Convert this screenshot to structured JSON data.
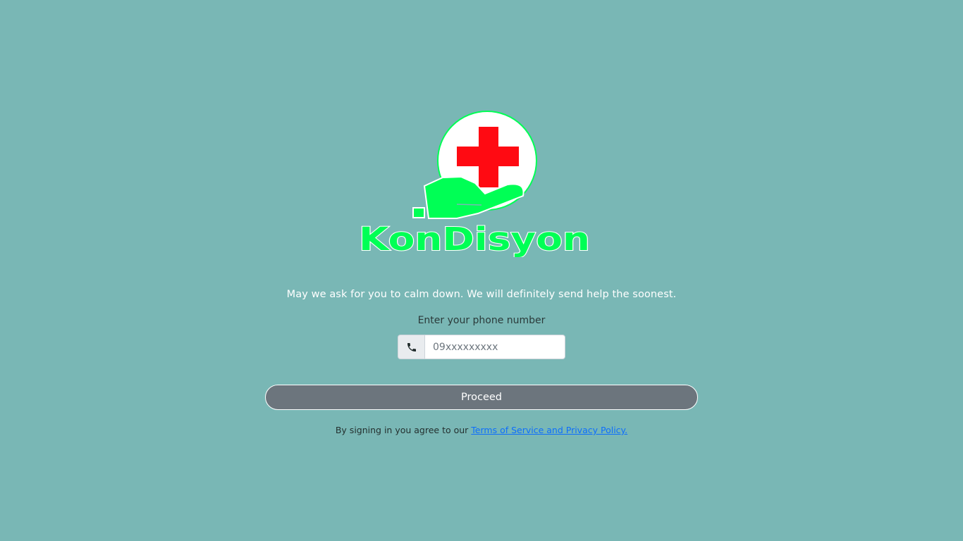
{
  "logo": {
    "text": "KonDisyon"
  },
  "colors": {
    "background": "#79b7b5",
    "brand_green": "#00ff55",
    "cross_red": "#ff0a12",
    "button": "#6c757d",
    "link": "#0d6efd"
  },
  "message": "May we ask for you to calm down. We will definitely send help the soonest.",
  "phone": {
    "label": "Enter your phone number",
    "placeholder": "09xxxxxxxxx",
    "value": "",
    "icon": "phone-icon"
  },
  "proceed_label": "Proceed",
  "legal": {
    "prefix": "By signing in you agree to our ",
    "link_text": "Terms of Service and Privacy Policy."
  }
}
